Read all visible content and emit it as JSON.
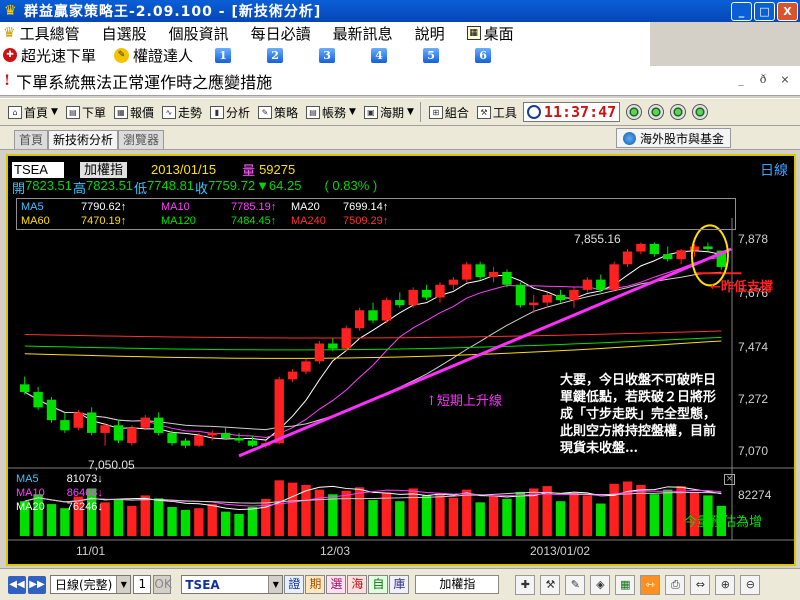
{
  "window": {
    "title": "群益贏家策略王-2.09.100 - [新技術分析]",
    "minimize": "_",
    "maximize": "□",
    "close": "X"
  },
  "menu1": {
    "items": [
      "工具總管",
      "自選股",
      "個股資訊",
      "每日必讀",
      "最新訊息",
      "說明"
    ],
    "desk": "桌面"
  },
  "menu2": {
    "speed_order": "超光速下單",
    "warrant_expert": "權證達人",
    "numbers": [
      "1",
      "2",
      "3",
      "4",
      "5",
      "6"
    ]
  },
  "notice": {
    "text": "下單系統無法正常運作時之應變措施",
    "mdi": [
      "_",
      "ð",
      "×"
    ]
  },
  "toolbar": {
    "items": [
      {
        "label": "首頁",
        "icon": "home-icon",
        "dropdown": true
      },
      {
        "label": "下單",
        "icon": "order-icon",
        "dropdown": false
      },
      {
        "label": "報價",
        "icon": "quote-icon",
        "dropdown": false
      },
      {
        "label": "走勢",
        "icon": "trend-icon",
        "dropdown": false
      },
      {
        "label": "分析",
        "icon": "analysis-icon",
        "dropdown": false
      },
      {
        "label": "策略",
        "icon": "strategy-icon",
        "dropdown": false
      },
      {
        "label": "帳務",
        "icon": "account-icon",
        "dropdown": true
      },
      {
        "label": "海期",
        "icon": "futures-icon",
        "dropdown": true
      },
      {
        "label": "組合",
        "icon": "combo-icon",
        "dropdown": false
      },
      {
        "label": "工具",
        "icon": "tools-icon",
        "dropdown": false
      }
    ],
    "time": "11:37:47"
  },
  "tabs": {
    "items": [
      "首頁",
      "新技術分析",
      "瀏覽器"
    ],
    "active": 1,
    "overseas": "海外股市與基金"
  },
  "chart_header": {
    "symbol": "TSEA",
    "name": "加權指",
    "date": "2013/01/15",
    "volume_label": "量",
    "volume": "59275",
    "period": "日線",
    "open_label": "開",
    "open": "7823.51",
    "high_label": "高",
    "high": "7823.51",
    "low_label": "低",
    "low": "7748.81",
    "close_label": "收",
    "close": "7759.72",
    "change": "▼64.25",
    "pct": "( 0.83% )"
  },
  "ma_legend": {
    "ma5": {
      "label": "MA5",
      "value": "7790.62↑",
      "color": "#ffffff"
    },
    "ma10": {
      "label": "MA10",
      "value": "7785.19↑",
      "color": "#ff40ff"
    },
    "ma20": {
      "label": "MA20",
      "value": "7699.14↑",
      "color": "#ffffff"
    },
    "ma60": {
      "label": "MA60",
      "value": "7470.19↑",
      "color": "#ffe000"
    },
    "ma120": {
      "label": "MA120",
      "value": "7484.45↑",
      "color": "#00e000"
    },
    "ma240": {
      "label": "MA240",
      "value": "7509.29↑",
      "color": "#ff3030"
    }
  },
  "vol_legend": {
    "ma5": {
      "label": "MA5",
      "value": "81073↓"
    },
    "ma10": {
      "label": "MA10",
      "value": "86468↓"
    },
    "ma20": {
      "label": "MA20",
      "value": "76246↓"
    }
  },
  "annotations": {
    "short_up": "↑短期上升線",
    "prev_low": "←昨低支撐",
    "volume_note": "今量預估為增",
    "commentary": "大要，今日收盤不可破昨日單鍵低點，若跌破２日將形成「寸步走跌」完全型態，此則空方將持控盤權，目前現貨未收盤…",
    "high_label": "7,855.16",
    "low_label": "7,050.05",
    "vol_axis": "82274"
  },
  "chart_data": {
    "type": "candlestick",
    "price_axis": {
      "ticks": [
        "7,878",
        "7,676",
        "7,474",
        "7,272",
        "7,070"
      ],
      "ylim": [
        7000,
        7920
      ]
    },
    "x_ticks": [
      "11/01",
      "12/03",
      "2013/01/02"
    ],
    "candles": [
      [
        7300,
        7330,
        7260,
        7270
      ],
      [
        7270,
        7290,
        7200,
        7210
      ],
      [
        7240,
        7250,
        7150,
        7160
      ],
      [
        7160,
        7190,
        7110,
        7120
      ],
      [
        7130,
        7200,
        7120,
        7190
      ],
      [
        7190,
        7210,
        7100,
        7110
      ],
      [
        7110,
        7150,
        7060,
        7140
      ],
      [
        7140,
        7160,
        7070,
        7080
      ],
      [
        7070,
        7140,
        7060,
        7130
      ],
      [
        7130,
        7180,
        7120,
        7170
      ],
      [
        7170,
        7190,
        7100,
        7110
      ],
      [
        7110,
        7120,
        7060,
        7070
      ],
      [
        7080,
        7090,
        7050,
        7060
      ],
      [
        7060,
        7110,
        7055,
        7100
      ],
      [
        7100,
        7120,
        7080,
        7110
      ],
      [
        7110,
        7130,
        7090,
        7090
      ],
      [
        7090,
        7110,
        7070,
        7080
      ],
      [
        7080,
        7100,
        7055,
        7060
      ],
      [
        7060,
        7080,
        7050,
        7070
      ],
      [
        7070,
        7330,
        7065,
        7320
      ],
      [
        7320,
        7360,
        7310,
        7350
      ],
      [
        7350,
        7400,
        7340,
        7390
      ],
      [
        7390,
        7470,
        7380,
        7460
      ],
      [
        7460,
        7480,
        7430,
        7440
      ],
      [
        7440,
        7530,
        7430,
        7520
      ],
      [
        7520,
        7600,
        7510,
        7590
      ],
      [
        7590,
        7620,
        7540,
        7550
      ],
      [
        7550,
        7640,
        7540,
        7630
      ],
      [
        7630,
        7660,
        7600,
        7610
      ],
      [
        7610,
        7680,
        7600,
        7670
      ],
      [
        7670,
        7690,
        7630,
        7640
      ],
      [
        7640,
        7700,
        7620,
        7690
      ],
      [
        7690,
        7720,
        7670,
        7710
      ],
      [
        7710,
        7780,
        7700,
        7770
      ],
      [
        7770,
        7780,
        7710,
        7720
      ],
      [
        7720,
        7760,
        7700,
        7740
      ],
      [
        7740,
        7750,
        7680,
        7690
      ],
      [
        7690,
        7700,
        7600,
        7610
      ],
      [
        7610,
        7650,
        7580,
        7620
      ],
      [
        7620,
        7660,
        7600,
        7650
      ],
      [
        7650,
        7670,
        7620,
        7630
      ],
      [
        7630,
        7680,
        7600,
        7670
      ],
      [
        7670,
        7720,
        7660,
        7710
      ],
      [
        7710,
        7730,
        7660,
        7670
      ],
      [
        7670,
        7780,
        7665,
        7770
      ],
      [
        7770,
        7830,
        7760,
        7820
      ],
      [
        7820,
        7856,
        7810,
        7850
      ],
      [
        7850,
        7855,
        7800,
        7810
      ],
      [
        7810,
        7840,
        7780,
        7790
      ],
      [
        7790,
        7830,
        7770,
        7825
      ],
      [
        7825,
        7850,
        7800,
        7840
      ],
      [
        7840,
        7855,
        7820,
        7830
      ],
      [
        7823.51,
        7823.51,
        7748.81,
        7759.72
      ]
    ],
    "volumes": [
      60,
      72,
      55,
      48,
      68,
      82,
      58,
      62,
      52,
      70,
      65,
      50,
      45,
      48,
      55,
      42,
      38,
      50,
      64,
      96,
      92,
      88,
      80,
      72,
      78,
      84,
      62,
      75,
      60,
      82,
      70,
      74,
      66,
      80,
      58,
      68,
      64,
      76,
      82,
      86,
      60,
      74,
      70,
      56,
      90,
      94,
      88,
      72,
      80,
      86,
      76,
      70,
      52
    ],
    "series": [
      {
        "name": "MA5",
        "color": "#ffffff"
      },
      {
        "name": "MA10",
        "color": "#ff40ff"
      },
      {
        "name": "MA20",
        "color": "#ffffff"
      },
      {
        "name": "MA60",
        "color": "#ffe000"
      },
      {
        "name": "MA120",
        "color": "#00e000"
      },
      {
        "name": "MA240",
        "color": "#ff3030"
      }
    ]
  },
  "bottom": {
    "period_select": "日線(完整)",
    "num": "1",
    "ok": "OK",
    "symbol": "TSEA",
    "col_buttons": [
      "證",
      "期",
      "選",
      "海",
      "自",
      "庫"
    ],
    "name": "加權指"
  }
}
